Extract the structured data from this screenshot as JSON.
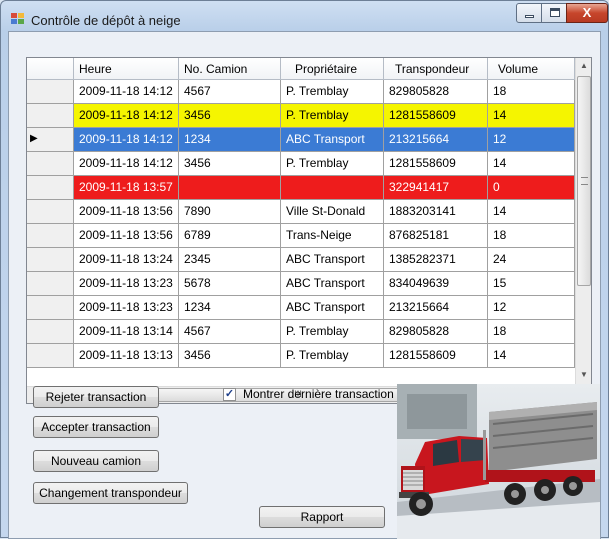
{
  "window": {
    "title": "Contrôle de dépôt à neige",
    "close_glyph": "X",
    "app_icon": "grid-app-icon"
  },
  "grid": {
    "columns": [
      "Heure",
      "No. Camion",
      "Propriétaire",
      "Transpondeur",
      "Volume"
    ],
    "rows": [
      {
        "heure": "2009-11-18 14:12",
        "camion": "4567",
        "proprietaire": "P. Tremblay",
        "transpondeur": "829805828",
        "volume": "18",
        "status": "normal"
      },
      {
        "heure": "2009-11-18 14:12",
        "camion": "3456",
        "proprietaire": "P. Tremblay",
        "transpondeur": "1281558609",
        "volume": "14",
        "status": "warning"
      },
      {
        "heure": "2009-11-18 14:12",
        "camion": "1234",
        "proprietaire": "ABC Transport",
        "transpondeur": "213215664",
        "volume": "12",
        "status": "selected"
      },
      {
        "heure": "2009-11-18 14:12",
        "camion": "3456",
        "proprietaire": "P. Tremblay",
        "transpondeur": "1281558609",
        "volume": "14",
        "status": "normal"
      },
      {
        "heure": "2009-11-18 13:57",
        "camion": "",
        "proprietaire": "",
        "transpondeur": "322941417",
        "volume": "0",
        "status": "error"
      },
      {
        "heure": "2009-11-18 13:56",
        "camion": "7890",
        "proprietaire": "Ville St-Donald",
        "transpondeur": "1883203141",
        "volume": "14",
        "status": "normal"
      },
      {
        "heure": "2009-11-18 13:56",
        "camion": "6789",
        "proprietaire": "Trans-Neige",
        "transpondeur": "876825181",
        "volume": "18",
        "status": "normal"
      },
      {
        "heure": "2009-11-18 13:24",
        "camion": "2345",
        "proprietaire": "ABC Transport",
        "transpondeur": "1385282371",
        "volume": "24",
        "status": "normal"
      },
      {
        "heure": "2009-11-18 13:23",
        "camion": "5678",
        "proprietaire": "ABC Transport",
        "transpondeur": "834049639",
        "volume": "15",
        "status": "normal"
      },
      {
        "heure": "2009-11-18 13:23",
        "camion": "1234",
        "proprietaire": "ABC Transport",
        "transpondeur": "213215664",
        "volume": "12",
        "status": "normal"
      },
      {
        "heure": "2009-11-18 13:14",
        "camion": "4567",
        "proprietaire": "P. Tremblay",
        "transpondeur": "829805828",
        "volume": "18",
        "status": "normal"
      },
      {
        "heure": "2009-11-18 13:13",
        "camion": "3456",
        "proprietaire": "P. Tremblay",
        "transpondeur": "1281558609",
        "volume": "14",
        "status": "normal"
      }
    ],
    "current_row_glyph": "▶",
    "hscroll_grip": "III",
    "status_colors": {
      "normal": "#ffffff",
      "warning": "#f5f500",
      "selected": "#3b7bd4",
      "error": "#ee1c1c"
    }
  },
  "actions": {
    "reject": "Rejeter transaction",
    "accept": "Accepter transaction",
    "new_truck": "Nouveau camion",
    "change_transponder": "Changement transpondeur",
    "report": "Rapport"
  },
  "options": {
    "show_last_label": "Montrer dernière transaction",
    "show_last_checked": true
  },
  "photo": {
    "subject": "red-dump-truck-photo"
  }
}
